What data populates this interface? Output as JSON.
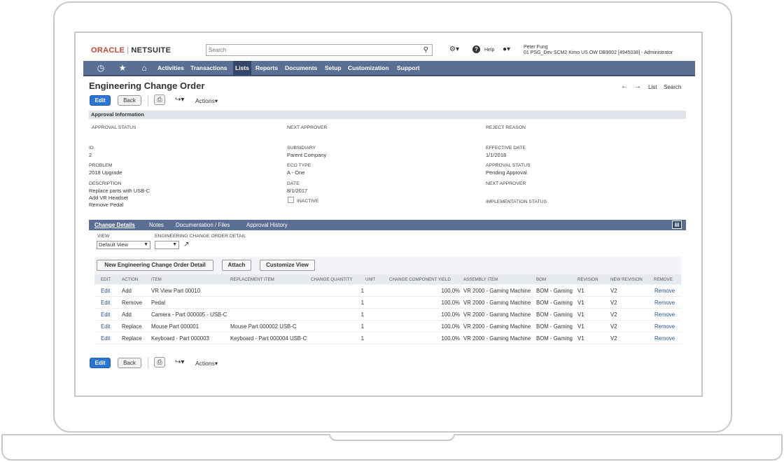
{
  "brand": {
    "oracle": "ORACLE",
    "sep": "|",
    "netsuite": "NETSUITE"
  },
  "search": {
    "placeholder": "Search"
  },
  "header": {
    "help_label": "Help",
    "user_name": "Peter Fung",
    "user_role": "01 PSG_Dev SCM2 Kimo US OW DB9002 [4945038] - Administrator"
  },
  "nav": {
    "items": [
      "Activities",
      "Transactions",
      "Lists",
      "Reports",
      "Documents",
      "Setup",
      "Customization",
      "Support"
    ],
    "active": "Lists"
  },
  "page": {
    "title": "Engineering Change Order",
    "list_link": "List",
    "search_link": "Search",
    "edit_label": "Edit",
    "back_label": "Back",
    "actions_label": "Actions"
  },
  "approval": {
    "section_title": "Approval Information",
    "approval_status_label": "APPROVAL STATUS",
    "next_approver_label": "NEXT APPROVER",
    "reject_reason_label": "REJECT REASON"
  },
  "fields": {
    "id_label": "ID",
    "id_value": "2",
    "problem_label": "PROBLEM",
    "problem_value": "2018 Upgrade",
    "description_label": "DESCRIPTION",
    "description_lines": [
      "Replace parts with USB-C",
      "Add VR Headset",
      "Remove Pedal"
    ],
    "subsidiary_label": "SUBSIDIARY",
    "subsidiary_value": "Parent Company",
    "eco_type_label": "ECO TYPE",
    "eco_type_value": "A - One",
    "date_label": "DATE",
    "date_value": "8/1/2017",
    "inactive_label": "INACTIVE",
    "effective_date_label": "EFFECTIVE DATE",
    "effective_date_value": "1/1/2018",
    "approval_status_label": "APPROVAL STATUS",
    "approval_status_value": "Pending Approval",
    "next_approver_label": "NEXT APPROVER",
    "implementation_status_label": "IMPLEMENTATION STATUS"
  },
  "subtabs": {
    "items": [
      "Change Details",
      "Notes",
      "Documentation / Files",
      "Approval History"
    ],
    "active": "Change Details"
  },
  "detail": {
    "view_label": "VIEW",
    "view_value": "Default View",
    "eco_detail_label": "ENGINEERING CHANGE ORDER DETAIL",
    "buttons": [
      "New Engineering Change Order Detail",
      "Attach",
      "Customize View"
    ],
    "columns": [
      "EDIT",
      "ACTION",
      "ITEM",
      "REPLACEMENT ITEM",
      "CHANGE QUANTITY",
      "UNIT",
      "CHANGE COMPONENT YIELD",
      "ASSEMBLY ITEM",
      "BOM",
      "REVISION",
      "NEW REVISION",
      "REMOVE"
    ],
    "rows": [
      {
        "edit": "Edit",
        "action": "Add",
        "item": "VR View Part 00010",
        "replacement": "",
        "qty": "1",
        "unit": "",
        "yield": "100.0%",
        "assembly": "VR 2000 - Gaming Machine",
        "bom": "BOM - Gaming",
        "revision": "V1",
        "new_revision": "V2",
        "remove": "Remove"
      },
      {
        "edit": "Edit",
        "action": "Remove",
        "item": "Pedal",
        "replacement": "",
        "qty": "1",
        "unit": "",
        "yield": "100.0%",
        "assembly": "VR 2000 - Gaming Machine",
        "bom": "BOM - Gaming",
        "revision": "V1",
        "new_revision": "V2",
        "remove": "Remove"
      },
      {
        "edit": "Edit",
        "action": "Add",
        "item": "Camera - Part 000005 - USB-C",
        "replacement": "",
        "qty": "1",
        "unit": "",
        "yield": "100.0%",
        "assembly": "VR 2000 - Gaming Machine",
        "bom": "BOM - Gaming",
        "revision": "V1",
        "new_revision": "V2",
        "remove": "Remove"
      },
      {
        "edit": "Edit",
        "action": "Replace",
        "item": "Mouse Part 000001",
        "replacement": "Mouse Part 000002 USB-C",
        "qty": "1",
        "unit": "",
        "yield": "100.0%",
        "assembly": "VR 2000 - Gaming Machine",
        "bom": "BOM - Gaming",
        "revision": "V1",
        "new_revision": "V2",
        "remove": "Remove"
      },
      {
        "edit": "Edit",
        "action": "Replace",
        "item": "Keyboard - Part 000003",
        "replacement": "Keyboard - Part 000004 USB-C",
        "qty": "1",
        "unit": "",
        "yield": "100.0%",
        "assembly": "VR 2000 - Gaming Machine",
        "bom": "BOM - Gaming",
        "revision": "V1",
        "new_revision": "V2",
        "remove": "Remove"
      }
    ]
  },
  "colors": {
    "nav": "#5a6f93",
    "primary_button": "#2a74d6",
    "oracle_red": "#c74634"
  }
}
